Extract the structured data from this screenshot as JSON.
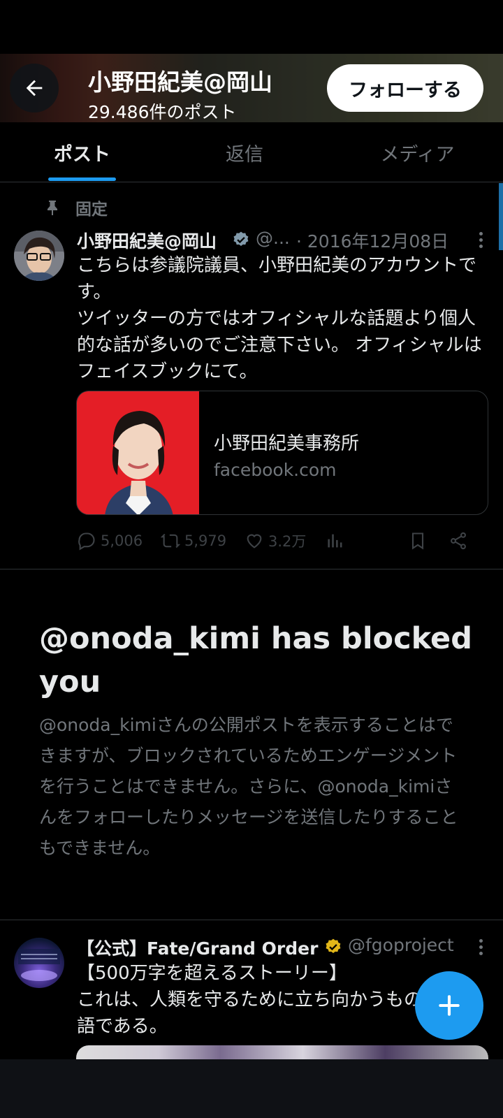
{
  "header": {
    "title": "小野田紀美@岡山",
    "post_count": "29.486件のポスト",
    "follow_label": "フォローする"
  },
  "tabs": [
    {
      "label": "ポスト",
      "active": true
    },
    {
      "label": "返信",
      "active": false
    },
    {
      "label": "メディア",
      "active": false
    }
  ],
  "pinned_tweet": {
    "pinned_label": "固定",
    "name": "小野田紀美@岡山",
    "handle": "@...",
    "date": "· 2016年12月08日",
    "text": "こちらは参議院議員、小野田紀美のアカウントです。\nツイッターの方ではオフィシャルな話題より個人的な話が多いのでご注意下さい。 オフィシャルはフェイスブックにて。",
    "card": {
      "title": "小野田紀美事務所",
      "domain": "facebook.com"
    },
    "stats": {
      "replies": "5,006",
      "reposts": "5,979",
      "likes": "3.2万"
    }
  },
  "blocked": {
    "title": "@onoda_kimi has blocked you",
    "body": "@onoda_kimiさんの公開ポストを表示することはできますが、ブロックされているためエンゲージメントを行うことはできません。さらに、@onoda_kimiさんをフォローしたりメッセージを送信したりすることもできません。"
  },
  "second_tweet": {
    "name": "【公式】Fate/Grand Order",
    "handle": "@fgoproject",
    "text": "【500万字を超えるストーリー】\nこれは、人類を守るために立ち向かうもの達の物語である。"
  },
  "colors": {
    "accent": "#1d9bf0",
    "verified_blue": "#1d9bf0",
    "verified_gold": "#e2b719",
    "muted": "#71767b",
    "card_red": "#e41e26"
  },
  "icons": [
    "arrow-left-icon",
    "pin-icon",
    "verified-icon",
    "more-icon",
    "reply-icon",
    "repost-icon",
    "like-icon",
    "views-icon",
    "bookmark-icon",
    "share-icon",
    "plus-icon"
  ]
}
